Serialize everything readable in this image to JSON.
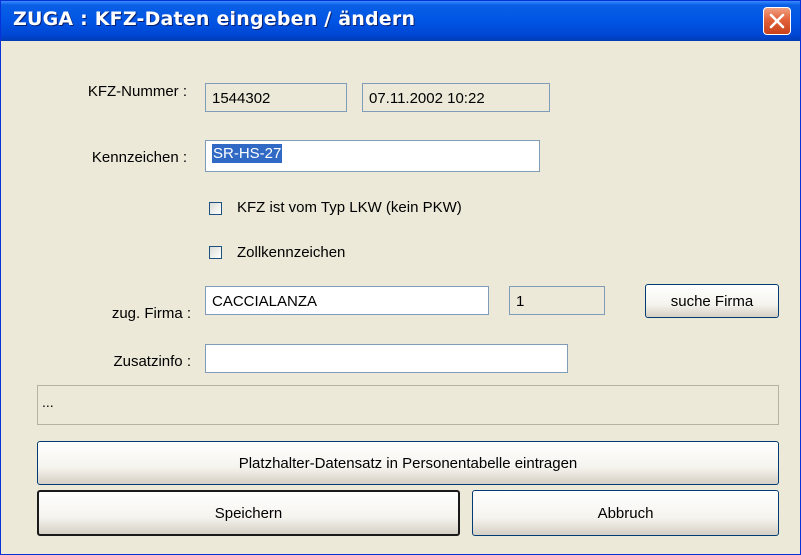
{
  "window": {
    "title": "ZUGA : KFZ-Daten eingeben / ändern"
  },
  "form": {
    "kfz_nummer_label": "KFZ-Nummer :",
    "kfz_nummer_value": "1544302",
    "timestamp_value": "07.11.2002 10:22",
    "kennzeichen_label": "Kennzeichen :",
    "kennzeichen_value": "SR-HS-27",
    "lkw_checkbox_label": "KFZ ist vom Typ LKW (kein PKW)",
    "lkw_checked": false,
    "zoll_checkbox_label": "Zollkennzeichen",
    "zoll_checked": false,
    "firma_label": "zug. Firma :",
    "firma_value": "CACCIALANZA",
    "firma_id_value": "1",
    "suche_firma_button": "suche Firma",
    "zusatzinfo_label": "Zusatzinfo :",
    "zusatzinfo_value": ""
  },
  "info_text": "...",
  "buttons": {
    "platzhalter": "Platzhalter-Datensatz in Personentabelle eintragen",
    "speichern": "Speichern",
    "abbruch": "Abbruch"
  },
  "colors": {
    "title_bar": "#0055E5",
    "window_bg": "#ECE9D8",
    "selection": "#316AC5",
    "close_button": "#E2623A"
  },
  "icons": {
    "close": "close-icon"
  }
}
